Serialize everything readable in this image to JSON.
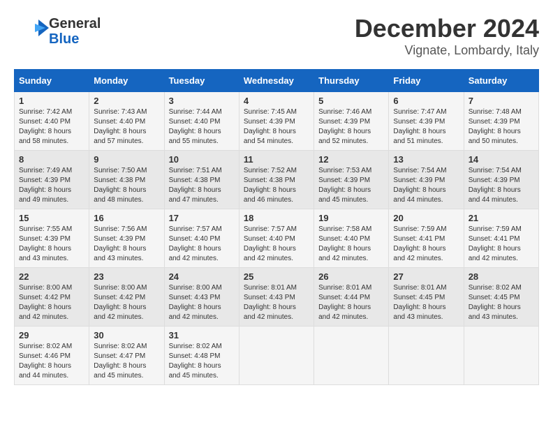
{
  "header": {
    "logo": {
      "general": "General",
      "blue": "Blue"
    },
    "title": "December 2024",
    "location": "Vignate, Lombardy, Italy"
  },
  "calendar": {
    "days_of_week": [
      "Sunday",
      "Monday",
      "Tuesday",
      "Wednesday",
      "Thursday",
      "Friday",
      "Saturday"
    ],
    "weeks": [
      [
        {
          "day": "1",
          "sunrise": "7:42 AM",
          "sunset": "4:40 PM",
          "daylight": "8 hours and 58 minutes."
        },
        {
          "day": "2",
          "sunrise": "7:43 AM",
          "sunset": "4:40 PM",
          "daylight": "8 hours and 57 minutes."
        },
        {
          "day": "3",
          "sunrise": "7:44 AM",
          "sunset": "4:40 PM",
          "daylight": "8 hours and 55 minutes."
        },
        {
          "day": "4",
          "sunrise": "7:45 AM",
          "sunset": "4:39 PM",
          "daylight": "8 hours and 54 minutes."
        },
        {
          "day": "5",
          "sunrise": "7:46 AM",
          "sunset": "4:39 PM",
          "daylight": "8 hours and 52 minutes."
        },
        {
          "day": "6",
          "sunrise": "7:47 AM",
          "sunset": "4:39 PM",
          "daylight": "8 hours and 51 minutes."
        },
        {
          "day": "7",
          "sunrise": "7:48 AM",
          "sunset": "4:39 PM",
          "daylight": "8 hours and 50 minutes."
        }
      ],
      [
        {
          "day": "8",
          "sunrise": "7:49 AM",
          "sunset": "4:39 PM",
          "daylight": "8 hours and 49 minutes."
        },
        {
          "day": "9",
          "sunrise": "7:50 AM",
          "sunset": "4:38 PM",
          "daylight": "8 hours and 48 minutes."
        },
        {
          "day": "10",
          "sunrise": "7:51 AM",
          "sunset": "4:38 PM",
          "daylight": "8 hours and 47 minutes."
        },
        {
          "day": "11",
          "sunrise": "7:52 AM",
          "sunset": "4:38 PM",
          "daylight": "8 hours and 46 minutes."
        },
        {
          "day": "12",
          "sunrise": "7:53 AM",
          "sunset": "4:39 PM",
          "daylight": "8 hours and 45 minutes."
        },
        {
          "day": "13",
          "sunrise": "7:54 AM",
          "sunset": "4:39 PM",
          "daylight": "8 hours and 44 minutes."
        },
        {
          "day": "14",
          "sunrise": "7:54 AM",
          "sunset": "4:39 PM",
          "daylight": "8 hours and 44 minutes."
        }
      ],
      [
        {
          "day": "15",
          "sunrise": "7:55 AM",
          "sunset": "4:39 PM",
          "daylight": "8 hours and 43 minutes."
        },
        {
          "day": "16",
          "sunrise": "7:56 AM",
          "sunset": "4:39 PM",
          "daylight": "8 hours and 43 minutes."
        },
        {
          "day": "17",
          "sunrise": "7:57 AM",
          "sunset": "4:40 PM",
          "daylight": "8 hours and 42 minutes."
        },
        {
          "day": "18",
          "sunrise": "7:57 AM",
          "sunset": "4:40 PM",
          "daylight": "8 hours and 42 minutes."
        },
        {
          "day": "19",
          "sunrise": "7:58 AM",
          "sunset": "4:40 PM",
          "daylight": "8 hours and 42 minutes."
        },
        {
          "day": "20",
          "sunrise": "7:59 AM",
          "sunset": "4:41 PM",
          "daylight": "8 hours and 42 minutes."
        },
        {
          "day": "21",
          "sunrise": "7:59 AM",
          "sunset": "4:41 PM",
          "daylight": "8 hours and 42 minutes."
        }
      ],
      [
        {
          "day": "22",
          "sunrise": "8:00 AM",
          "sunset": "4:42 PM",
          "daylight": "8 hours and 42 minutes."
        },
        {
          "day": "23",
          "sunrise": "8:00 AM",
          "sunset": "4:42 PM",
          "daylight": "8 hours and 42 minutes."
        },
        {
          "day": "24",
          "sunrise": "8:00 AM",
          "sunset": "4:43 PM",
          "daylight": "8 hours and 42 minutes."
        },
        {
          "day": "25",
          "sunrise": "8:01 AM",
          "sunset": "4:43 PM",
          "daylight": "8 hours and 42 minutes."
        },
        {
          "day": "26",
          "sunrise": "8:01 AM",
          "sunset": "4:44 PM",
          "daylight": "8 hours and 42 minutes."
        },
        {
          "day": "27",
          "sunrise": "8:01 AM",
          "sunset": "4:45 PM",
          "daylight": "8 hours and 43 minutes."
        },
        {
          "day": "28",
          "sunrise": "8:02 AM",
          "sunset": "4:45 PM",
          "daylight": "8 hours and 43 minutes."
        }
      ],
      [
        {
          "day": "29",
          "sunrise": "8:02 AM",
          "sunset": "4:46 PM",
          "daylight": "8 hours and 44 minutes."
        },
        {
          "day": "30",
          "sunrise": "8:02 AM",
          "sunset": "4:47 PM",
          "daylight": "8 hours and 45 minutes."
        },
        {
          "day": "31",
          "sunrise": "8:02 AM",
          "sunset": "4:48 PM",
          "daylight": "8 hours and 45 minutes."
        },
        null,
        null,
        null,
        null
      ]
    ]
  }
}
